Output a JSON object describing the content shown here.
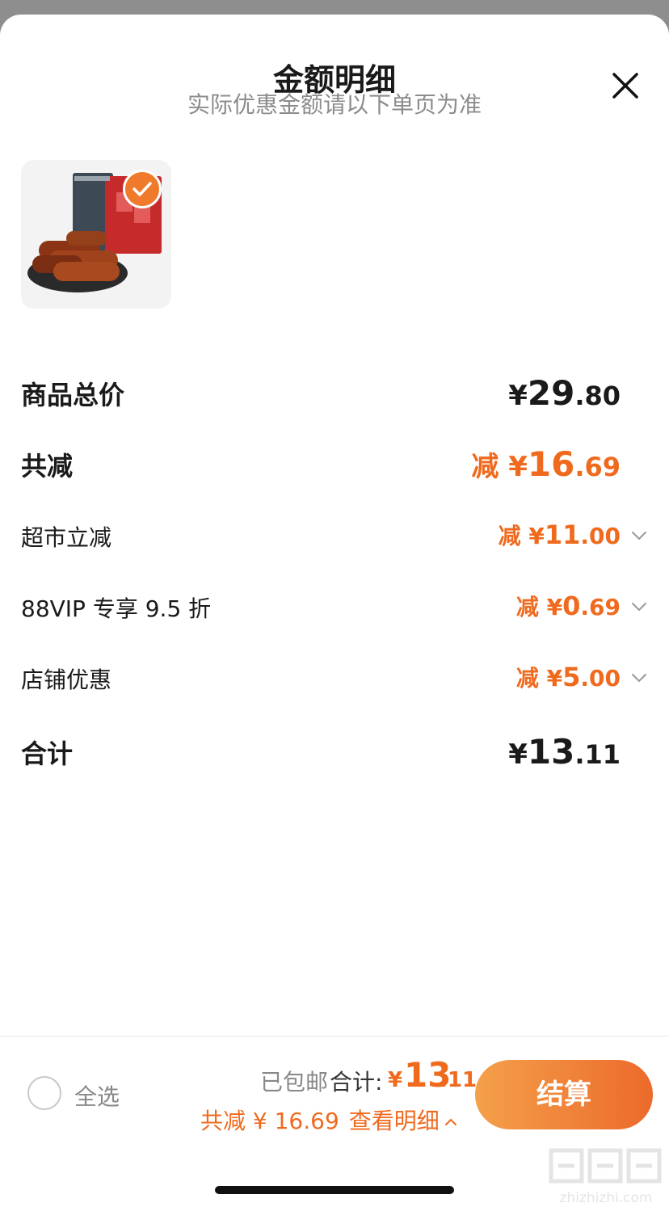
{
  "header": {
    "title": "金额明细",
    "subtitle": "实际优惠金额请以下单页为准",
    "close_icon": "close-icon"
  },
  "product": {
    "selected": true
  },
  "summary": {
    "goods_total": {
      "label": "商品总价",
      "yen": "¥",
      "int": "29",
      "dec": ".80"
    },
    "total_discount": {
      "label": "共减",
      "prefix": "减 ",
      "yen": "¥",
      "int": "16",
      "dec": ".69"
    },
    "discounts": [
      {
        "label": "超市立减",
        "prefix": "减 ",
        "yen": "¥",
        "int": "11",
        "dec": ".00"
      },
      {
        "label": "88VIP 专享 9.5 折",
        "prefix": "减 ",
        "yen": "¥",
        "int": "0",
        "dec": ".69"
      },
      {
        "label": "店铺优惠",
        "prefix": "减 ",
        "yen": "¥",
        "int": "5",
        "dec": ".00"
      }
    ],
    "subtotal": {
      "label": "合计",
      "yen": "¥",
      "int": "13",
      "dec": ".11"
    }
  },
  "footer": {
    "select_all": "全选",
    "shipping": "已包邮",
    "total_label": "合计:",
    "total_yen": "¥",
    "total_int": "13",
    "total_dec": ".11",
    "saved_text": "共减 ¥ 16.69",
    "view_detail": "查看明细",
    "checkout": "结算"
  },
  "watermark": {
    "site": "zhizhizhi.com"
  },
  "colors": {
    "accent": "#f06a1e",
    "button_start": "#f4a04a",
    "button_end": "#ec6a2b"
  }
}
